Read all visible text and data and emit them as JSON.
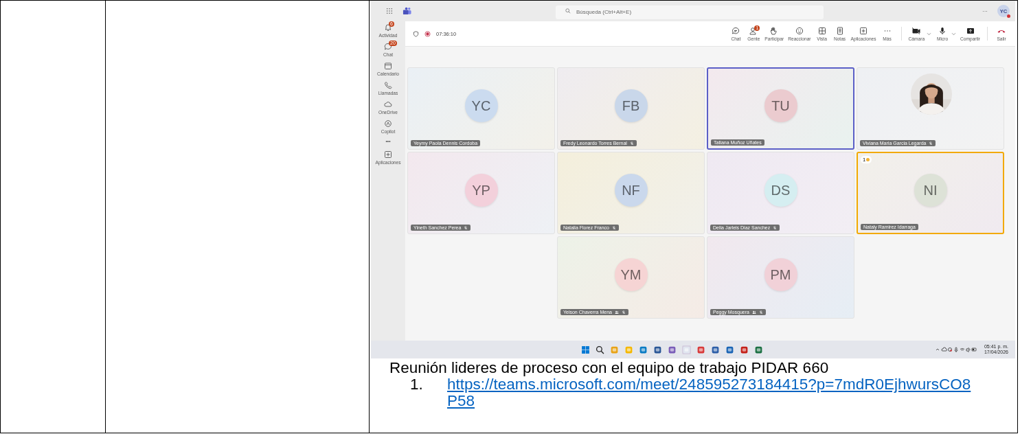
{
  "teams": {
    "search": {
      "placeholder": "Búsqueda (Ctrl+Alt+E)"
    },
    "more": "···",
    "account": {
      "initials": "YC"
    },
    "sidebar": [
      {
        "kind": "bell",
        "label": "Actividad",
        "badge": "6"
      },
      {
        "kind": "chat",
        "label": "Chat",
        "badge": "20"
      },
      {
        "kind": "calendar",
        "label": "Calendario"
      },
      {
        "kind": "phone",
        "label": "Llamadas"
      },
      {
        "kind": "cloud",
        "label": "OneDrive"
      },
      {
        "kind": "copilot",
        "label": "Copilot"
      },
      {
        "kind": "dots",
        "label": "•••"
      },
      {
        "kind": "apps",
        "label": "Aplicaciones"
      }
    ],
    "timer": "07:36:10",
    "toolbar": [
      {
        "kind": "chat",
        "label": "Chat"
      },
      {
        "kind": "people",
        "label": "Gente",
        "badge": "1"
      },
      {
        "kind": "hand",
        "label": "Participar"
      },
      {
        "kind": "smile",
        "label": "Reaccionar"
      },
      {
        "kind": "grid",
        "label": "Vista"
      },
      {
        "kind": "notes",
        "label": "Notas"
      },
      {
        "kind": "plus",
        "label": "Aplicaciones"
      },
      {
        "kind": "more",
        "label": "Más"
      },
      {
        "kind": "camera",
        "label": "Cámara"
      },
      {
        "kind": "mic",
        "label": "Micro"
      },
      {
        "kind": "share",
        "label": "Compartir"
      },
      {
        "kind": "leave",
        "label": "Salir"
      }
    ],
    "tiles": [
      {
        "kind": "initials",
        "initials": "YC",
        "color": "#cbdbef",
        "name": "Yeymy Paola Dennis Cordoba",
        "muted": false,
        "speaking": false,
        "hand": false,
        "dial_in": false
      },
      {
        "kind": "initials",
        "initials": "FB",
        "color": "#c9d7ea",
        "name": "Fredy Leonardo Torres Bernal",
        "muted": true,
        "speaking": false,
        "hand": false,
        "dial_in": false
      },
      {
        "kind": "initials",
        "initials": "TU",
        "color": "#ebcbcf",
        "name": "Tatiana Muñoz Uñates",
        "muted": false,
        "speaking": true,
        "hand": false,
        "dial_in": false
      },
      {
        "name": "Viviana Maria Garcia Legarda",
        "muted": true,
        "speaking": false,
        "hand": false,
        "dial_in": false
      },
      {
        "kind": "initials",
        "initials": "YP",
        "color": "#f3d0db",
        "name": "Yineth Sanchez Perea",
        "muted": true,
        "speaking": false,
        "hand": false,
        "dial_in": false
      },
      {
        "kind": "initials",
        "initials": "NF",
        "color": "#cad8ec",
        "name": "Natalia Florez Franco",
        "muted": true,
        "speaking": false,
        "hand": false,
        "dial_in": false
      },
      {
        "kind": "initials",
        "initials": "DS",
        "color": "#d5eef1",
        "name": "Delia Jarleis Diaz Sanchez",
        "muted": true,
        "speaking": false,
        "hand": false,
        "dial_in": false
      },
      {
        "kind": "initials",
        "initials": "NI",
        "color": "#dde2d7",
        "name": "Nataly Ramirez Idarraga",
        "muted": false,
        "speaking": false,
        "hand": true,
        "hand_count": "1",
        "dial_in": false
      },
      {
        "kind": "initials",
        "initials": "YM",
        "color": "#f6d4d4",
        "name": "Yeison Chaverra Mena",
        "muted": true,
        "speaking": false,
        "hand": false,
        "dial_in": true
      },
      {
        "kind": "initials",
        "initials": "PM",
        "color": "#f1d1d8",
        "name": "Peggy Mosquera",
        "muted": true,
        "speaking": false,
        "hand": false,
        "dial_in": true
      }
    ],
    "taskbar": {
      "time": "05:41 p. m.",
      "date": "17/04/2026"
    }
  },
  "caption": "Reunión lideres de proceso con el equipo de trabajo PIDAR 660",
  "links": [
    {
      "number": "1.",
      "url": "https://teams.microsoft.com/meet/248595273184415?p=7mdR0EjhwursCO8P58"
    }
  ]
}
